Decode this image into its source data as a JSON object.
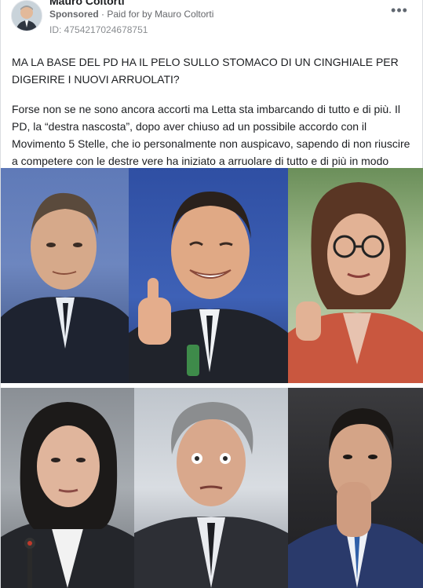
{
  "post": {
    "author": "Mauro Coltorti",
    "sponsored_label": "Sponsored",
    "paid_for_prefix": "· Paid for by",
    "paid_for_name": "Mauro Coltorti",
    "id_line": "ID: 4754217024678751",
    "paragraph1": "MA LA BASE DEL PD HA IL PELO SULLO STOMACO DI UN CINGHIALE PER DIGERIRE I NUOVI ARRUOLATI?",
    "paragraph2": "Forse non se ne sono ancora accorti ma Letta sta imbarcando di tutto e di più. Il PD, la “destra nascosta”, dopo aver chiuso ad un possibile accordo con il Movimento 5 Stelle, che io personalmente non auspicavo, sapendo di non riuscire a competere con le destre vere ha iniziato a arruolare di tutto e di più in modo da…"
  },
  "icons": {
    "more": "more-horizontal-icon"
  },
  "colors": {
    "text_primary": "#1c1e21",
    "text_secondary": "#65676b",
    "border": "#dadde1"
  }
}
